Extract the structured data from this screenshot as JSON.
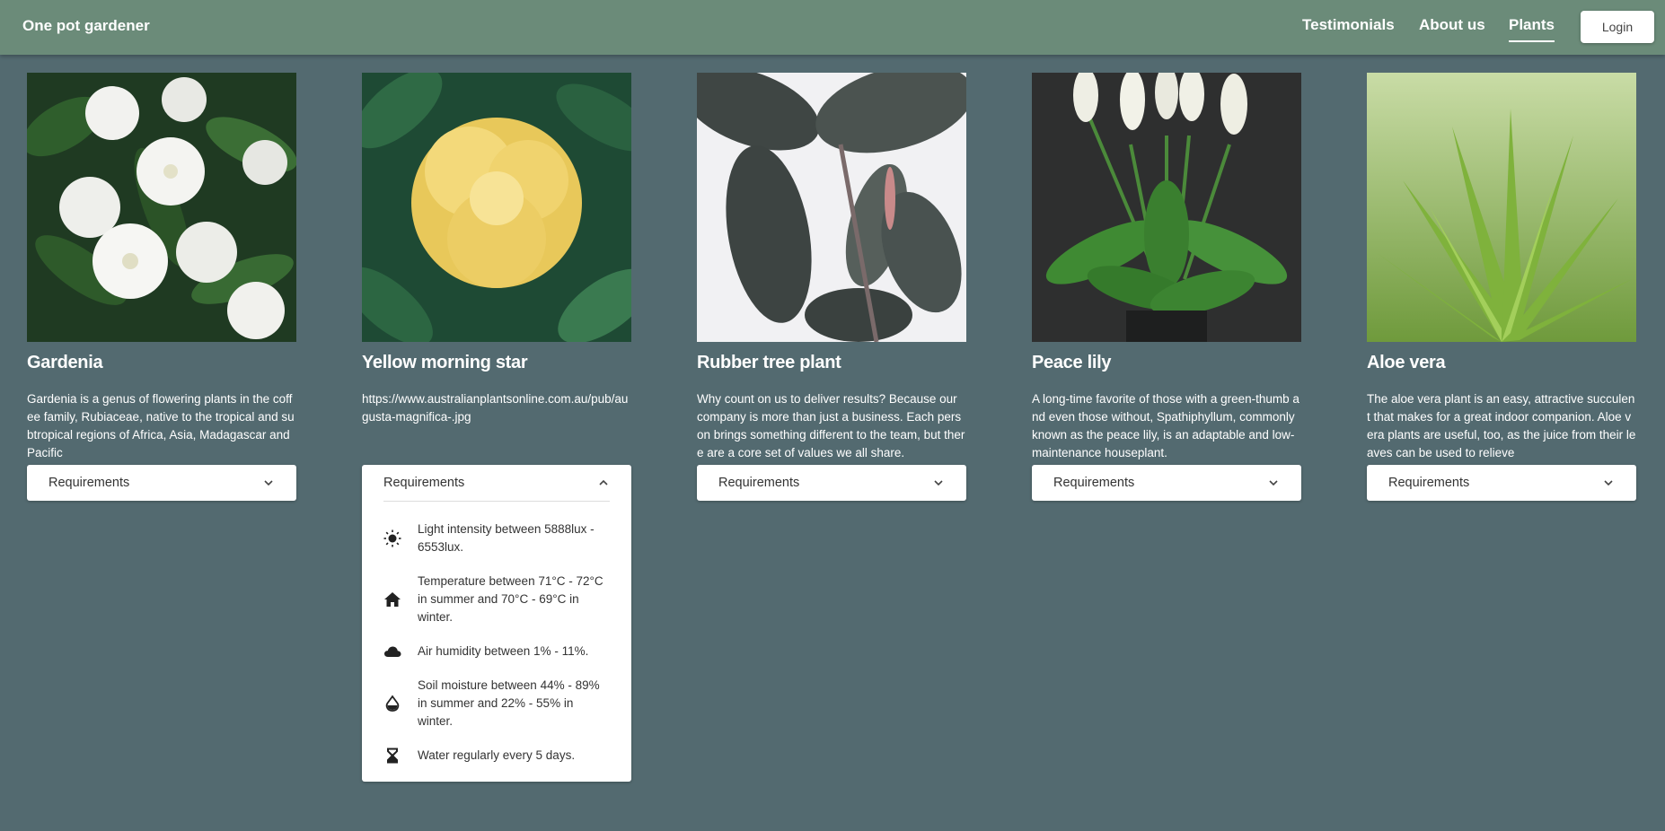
{
  "header": {
    "brand": "One pot gardener",
    "nav": [
      "Testimonials",
      "About us",
      "Plants"
    ],
    "active_nav": "Plants",
    "login_label": "Login"
  },
  "plants": [
    {
      "name": "Gardenia",
      "description": "Gardenia is a genus of flowering plants in the coffee family, Rubiaceae, native to the tropical and subtropical regions of Africa, Asia, Madagascar and Pacific",
      "requirements_label": "Requirements"
    },
    {
      "name": "Yellow morning star",
      "description": "https://www.australianplantsonline.com.au/pub/augusta-magnifica-.jpg",
      "requirements_label": "Requirements",
      "requirements": [
        {
          "icon": "sun-icon",
          "text": "Light intensity between 5888lux - 6553lux."
        },
        {
          "icon": "house-icon",
          "text": "Temperature between 71°C - 72°C in summer and 70°C - 69°C in winter."
        },
        {
          "icon": "cloud-icon",
          "text": "Air humidity between 1% - 11%."
        },
        {
          "icon": "water-drop-icon",
          "text": "Soil moisture between 44% - 89% in summer and 22% - 55% in winter."
        },
        {
          "icon": "hourglass-icon",
          "text": "Water regularly every 5 days."
        }
      ]
    },
    {
      "name": "Rubber tree plant",
      "description": "Why count on us to deliver results? Because our company is more than just a business. Each person brings something different to the team, but there are a core set of values we all share.",
      "requirements_label": "Requirements"
    },
    {
      "name": "Peace lily",
      "description": "A long-time favorite of those with a green-thumb and even those without, Spathiphyllum, commonly known as the peace lily, is an adaptable and low-maintenance houseplant.",
      "requirements_label": "Requirements"
    },
    {
      "name": "Aloe vera",
      "description": "The aloe vera plant is an easy, attractive succulent that makes for a great indoor companion. Aloe vera plants are useful, too, as the juice from their leaves can be used to relieve",
      "requirements_label": "Requirements"
    }
  ],
  "colors": {
    "page_bg": "#536a70",
    "header_bg": "#6b8b79"
  }
}
